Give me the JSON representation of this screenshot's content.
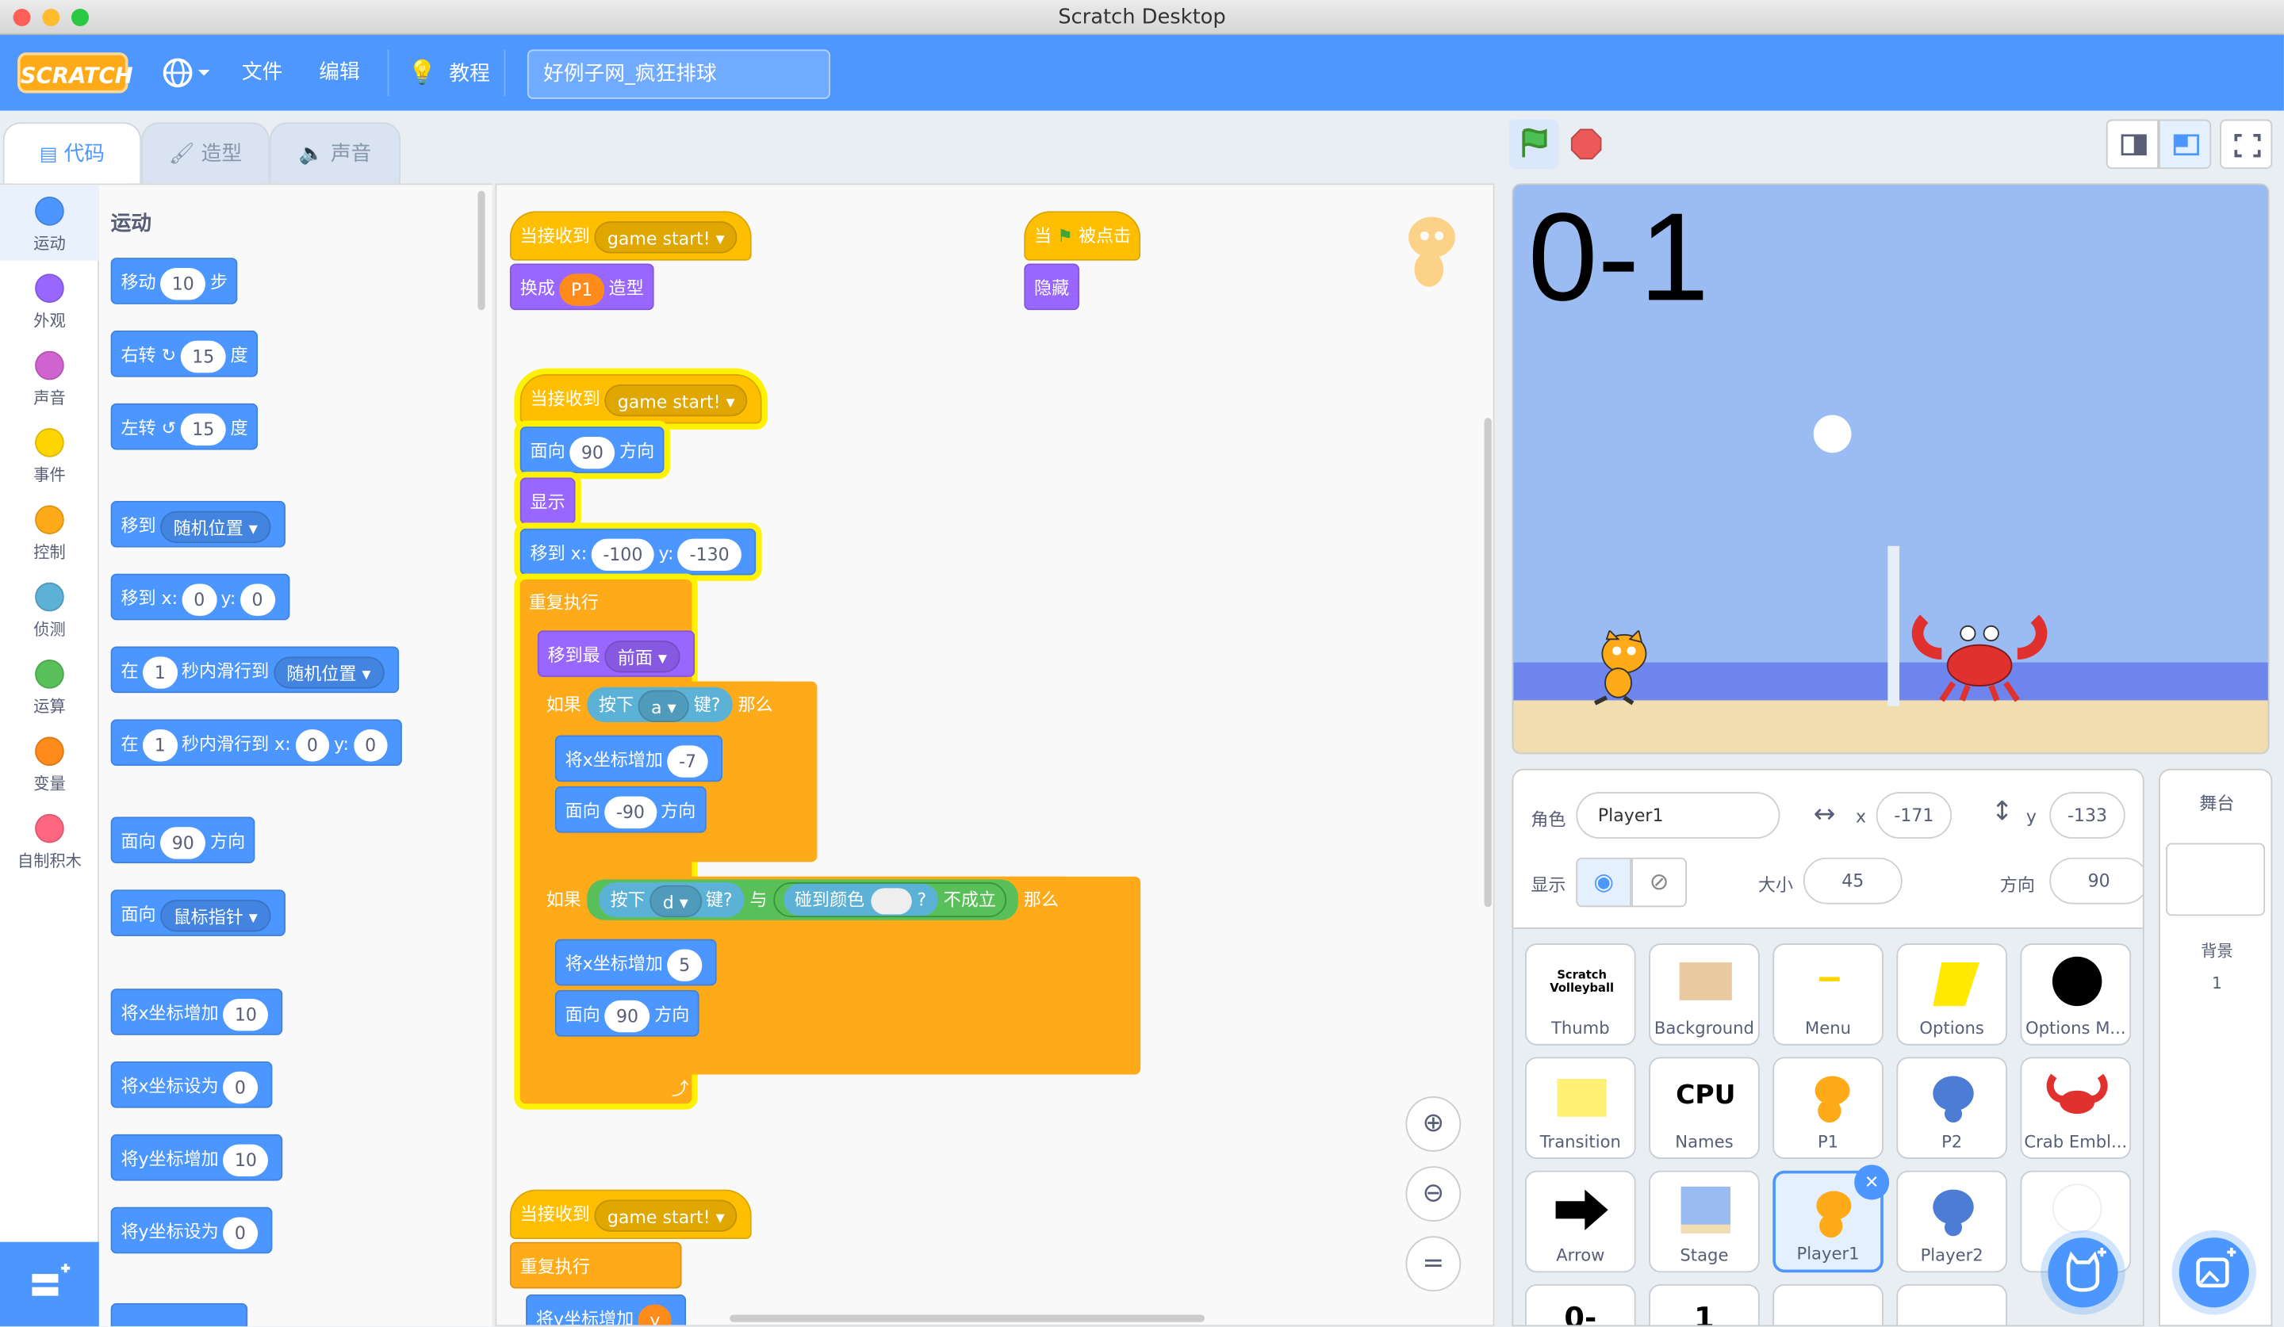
{
  "window": {
    "title": "Scratch Desktop"
  },
  "menu": {
    "logo": "SCRATCH",
    "file": "文件",
    "edit": "编辑",
    "tutorials": "教程",
    "project_title": "好例子网_疯狂排球"
  },
  "tabs": {
    "code": "代码",
    "costumes": "造型",
    "sounds": "声音"
  },
  "categories": [
    {
      "label": "运动",
      "color": "#4c97ff"
    },
    {
      "label": "外观",
      "color": "#9966ff"
    },
    {
      "label": "声音",
      "color": "#cf63cf"
    },
    {
      "label": "事件",
      "color": "#ffd500"
    },
    {
      "label": "控制",
      "color": "#ffab19"
    },
    {
      "label": "侦测",
      "color": "#5cb1d6"
    },
    {
      "label": "运算",
      "color": "#59c059"
    },
    {
      "label": "变量",
      "color": "#ff8c1a"
    },
    {
      "label": "自制积木",
      "color": "#ff6680"
    }
  ],
  "palette": {
    "heading": "运动",
    "move": "移动",
    "move_val": "10",
    "steps": "步",
    "turn_right": "右转",
    "turn_left": "左转",
    "deg_val": "15",
    "deg": "度",
    "goto": "移到",
    "random_pos": "随机位置",
    "goto_xy": "移到 x:",
    "x0": "0",
    "y_label": "y:",
    "y0": "0",
    "glide_in": "在",
    "glide_sec": "1",
    "glide_to": "秒内滑行到",
    "glide_xy": "秒内滑行到 x:",
    "point_dir": "面向",
    "dir_val": "90",
    "direction": "方向",
    "point_towards": "面向",
    "mouse": "鼠标指针",
    "change_x": "将x坐标增加",
    "change_x_val": "10",
    "set_x": "将x坐标设为",
    "set_x_val": "0",
    "change_y": "将y坐标增加",
    "change_y_val": "10",
    "set_y": "将y坐标设为",
    "set_y_val": "0"
  },
  "scripts": {
    "when_receive": "当接收到",
    "msg": "game start!",
    "switch_costume": "换成",
    "costume": "P1",
    "costume_word": "造型",
    "when_flag": "当",
    "clicked": "被点击",
    "hide": "隐藏",
    "point": "面向",
    "dir90": "90",
    "direction": "方向",
    "show": "显示",
    "goto_x": "移到 x:",
    "x_val": "-100",
    "y": "y:",
    "y_val": "-130",
    "forever": "重复执行",
    "go_front": "移到最",
    "front": "前面",
    "if": "如果",
    "key_pressed": "按下",
    "key_a": "a",
    "key_q": "键?",
    "then": "那么",
    "change_x": "将x坐标增加",
    "neg7": "-7",
    "dirm90": "-90",
    "key_d": "d",
    "and": "与",
    "touch_color": "碰到颜色",
    "qmark": "?",
    "not": "不成立",
    "five": "5",
    "change_y": "将y坐标增加",
    "yvar": "y"
  },
  "stage": {
    "score": "0-1"
  },
  "sprite_info": {
    "sprite_label": "角色",
    "sprite_name": "Player1",
    "x_label": "x",
    "x": "-171",
    "y_label": "y",
    "y": "-133",
    "show_label": "显示",
    "size_label": "大小",
    "size": "45",
    "dir_label": "方向",
    "direction": "90"
  },
  "stage_pane": {
    "title": "舞台",
    "backdrops": "背景",
    "count": "1"
  },
  "sprites": [
    {
      "name": "Thumb"
    },
    {
      "name": "Background"
    },
    {
      "name": "Menu"
    },
    {
      "name": "Options"
    },
    {
      "name": "Options M..."
    },
    {
      "name": "Transition"
    },
    {
      "name": "Names"
    },
    {
      "name": "P1"
    },
    {
      "name": "P2"
    },
    {
      "name": "Crab Embl..."
    },
    {
      "name": "Arrow"
    },
    {
      "name": "Stage"
    },
    {
      "name": "Player1"
    },
    {
      "name": "Player2"
    },
    {
      "name": ""
    }
  ],
  "thumbs": {
    "thumb_text": "Scratch Volleyball",
    "names_text": "CPU",
    "row4a": "0-",
    "row4b": "1"
  }
}
